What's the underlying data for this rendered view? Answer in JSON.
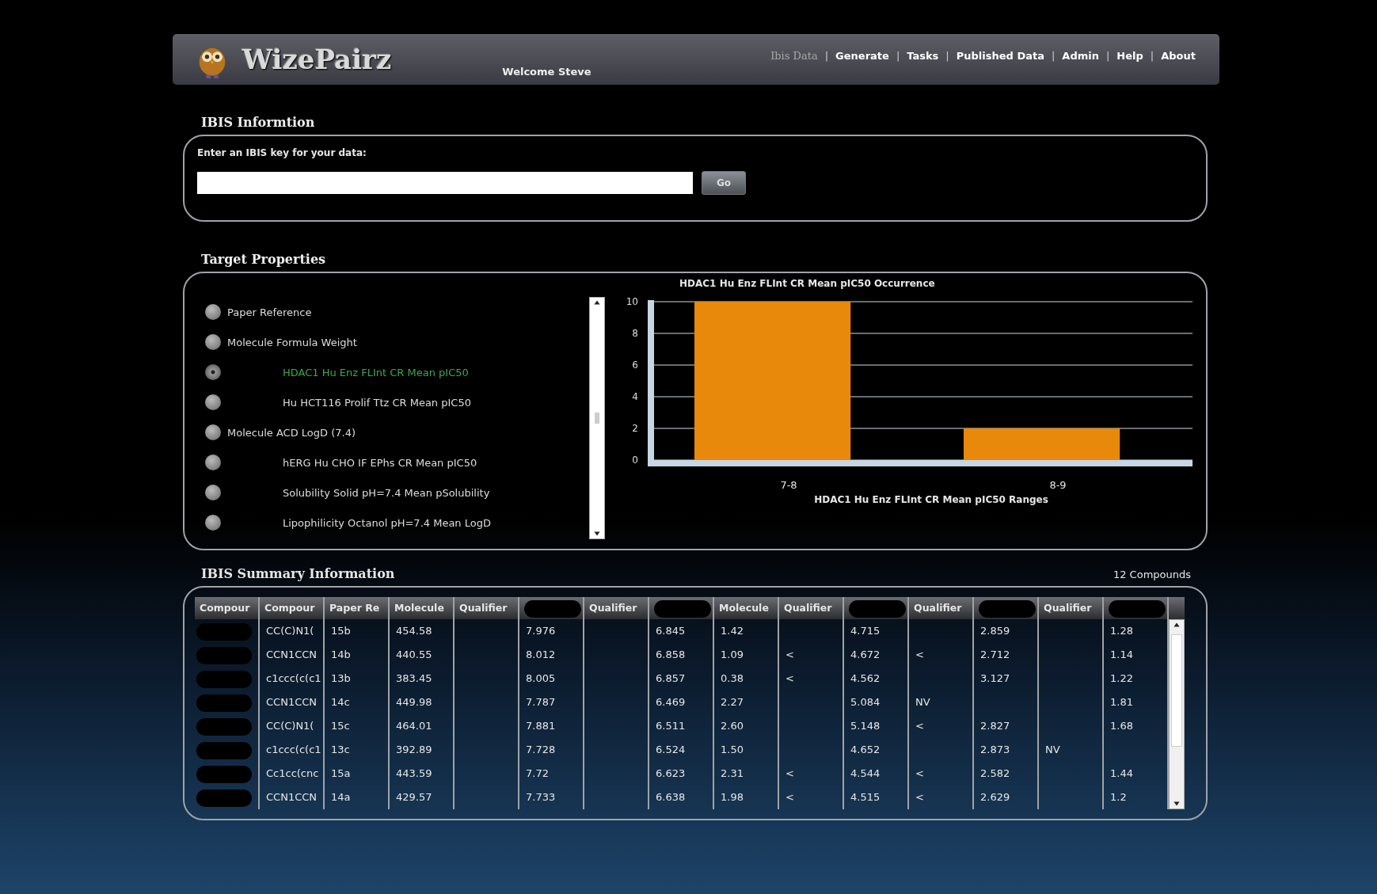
{
  "header": {
    "logo": "WizePairz",
    "welcome": "Welcome Steve",
    "separator": "|",
    "nav": [
      {
        "label": "Ibis Data",
        "selected": true
      },
      {
        "label": "Generate",
        "selected": false
      },
      {
        "label": "Tasks",
        "selected": false
      },
      {
        "label": "Published Data",
        "selected": false
      },
      {
        "label": "Admin",
        "selected": false
      },
      {
        "label": "Help",
        "selected": false
      },
      {
        "label": "About",
        "selected": false
      }
    ]
  },
  "ibis_info": {
    "title": "IBIS Informtion",
    "prompt": "Enter an IBIS key for your data:",
    "go_button": "Go"
  },
  "target_properties": {
    "title": "Target Properties",
    "items": [
      {
        "label": "Paper Reference",
        "kind": "plain",
        "selected": false
      },
      {
        "label": "Molecule Formula Weight",
        "kind": "plain",
        "selected": false
      },
      {
        "label": "HDAC1 Hu Enz FLInt CR  Mean pIC50",
        "kind": "indented",
        "selected": true
      },
      {
        "label": "Hu HCT116 Prolif Ttz CR  Mean pIC50",
        "kind": "indented",
        "selected": false
      },
      {
        "label": "Molecule ACD LogD (7.4)",
        "kind": "plain",
        "selected": false
      },
      {
        "label": "hERG Hu CHO IF EPhs CR  Mean pIC50",
        "kind": "indented",
        "selected": false
      },
      {
        "label": "Solubility Solid pH=7.4 Mean pSolubility",
        "kind": "indented",
        "selected": false
      },
      {
        "label": "Lipophilicity Octanol pH=7.4  Mean LogD",
        "kind": "indented",
        "selected": false
      }
    ],
    "chart_data": {
      "type": "bar",
      "title": "HDAC1 Hu Enz FLInt CR  Mean pIC50 Occurrence",
      "xlabel": "HDAC1 Hu Enz FLInt CR  Mean pIC50 Ranges",
      "categories": [
        "7-8",
        "8-9"
      ],
      "values": [
        10,
        2
      ],
      "grid": true,
      "ylim": [
        0,
        10
      ],
      "yticks": [
        0,
        2,
        4,
        6,
        8,
        10
      ]
    }
  },
  "summary": {
    "title": "IBIS Summary Information",
    "count": "12 Compounds",
    "columns": [
      {
        "label": "Compour",
        "kind": "redacted_cells"
      },
      {
        "label": "Compour",
        "kind": "text"
      },
      {
        "label": "Paper Re",
        "kind": "text"
      },
      {
        "label": "Molecule",
        "kind": "text"
      },
      {
        "label": "Qualifier",
        "kind": "text"
      },
      {
        "kind": "redacted_header"
      },
      {
        "label": "Qualifier",
        "kind": "text"
      },
      {
        "kind": "redacted_header"
      },
      {
        "label": "Molecule",
        "kind": "text"
      },
      {
        "label": "Qualifier",
        "kind": "text"
      },
      {
        "kind": "redacted_header"
      },
      {
        "label": "Qualifier",
        "kind": "text"
      },
      {
        "kind": "redacted_header"
      },
      {
        "label": "Qualifier",
        "kind": "text"
      },
      {
        "kind": "redacted_header"
      }
    ],
    "rows": [
      [
        null,
        "CC(C)N1(",
        "15b",
        "454.58",
        null,
        "7.976",
        null,
        "6.845",
        "1.42",
        null,
        "4.715",
        null,
        "2.859",
        null,
        "1.28"
      ],
      [
        null,
        "CCN1CCN",
        "14b",
        "440.55",
        null,
        "8.012",
        null,
        "6.858",
        "1.09",
        "<",
        "4.672",
        "<",
        "2.712",
        null,
        "1.14"
      ],
      [
        null,
        "c1ccc(c(c1",
        "13b",
        "383.45",
        null,
        "8.005",
        null,
        "6.857",
        "0.38",
        "<",
        "4.562",
        null,
        "3.127",
        null,
        "1.22"
      ],
      [
        null,
        "CCN1CCN",
        "14c",
        "449.98",
        null,
        "7.787",
        null,
        "6.469",
        "2.27",
        null,
        "5.084",
        "NV",
        null,
        null,
        "1.81"
      ],
      [
        null,
        "CC(C)N1(",
        "15c",
        "464.01",
        null,
        "7.881",
        null,
        "6.511",
        "2.60",
        null,
        "5.148",
        "<",
        "2.827",
        null,
        "1.68"
      ],
      [
        null,
        "c1ccc(c(c1",
        "13c",
        "392.89",
        null,
        "7.728",
        null,
        "6.524",
        "1.50",
        null,
        "4.652",
        null,
        "2.873",
        "NV",
        null
      ],
      [
        null,
        "Cc1cc(cnc",
        "15a",
        "443.59",
        null,
        "7.72",
        null,
        "6.623",
        "2.31",
        "<",
        "4.544",
        "<",
        "2.582",
        null,
        "1.44"
      ],
      [
        null,
        "CCN1CCN",
        "14a",
        "429.57",
        null,
        "7.733",
        null,
        "6.638",
        "1.98",
        "<",
        "4.515",
        "<",
        "2.629",
        null,
        "1.2"
      ]
    ]
  }
}
